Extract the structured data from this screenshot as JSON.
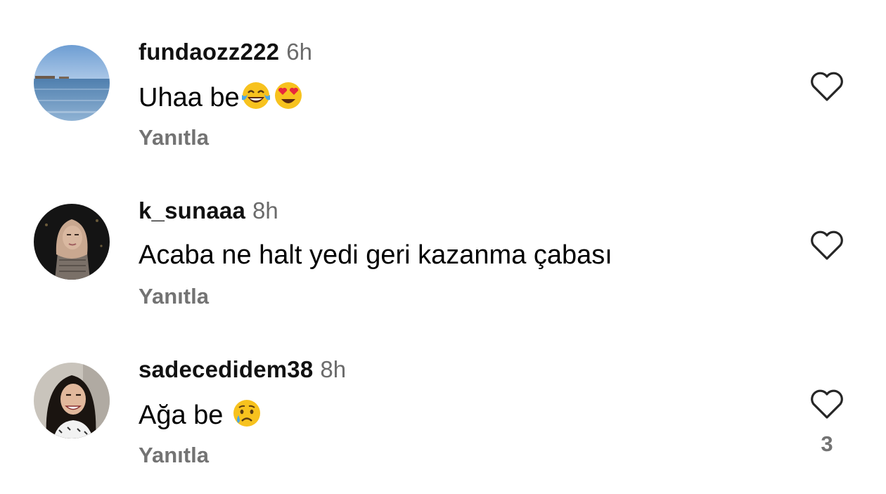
{
  "comments": [
    {
      "username": "fundaozz222",
      "time": "6h",
      "text": "Uhaa be",
      "emojis": [
        "face-with-tears-of-joy",
        "smiling-face-with-heart-eyes"
      ],
      "reply_label": "Yanıtla"
    },
    {
      "username": "k_sunaaa",
      "time": "8h",
      "text": "Acaba ne halt yedi geri kazanma çabası",
      "emojis": [],
      "reply_label": "Yanıtla"
    },
    {
      "username": "sadecedidem38",
      "time": "8h",
      "text": "Ağa be ",
      "emojis": [
        "crying-face"
      ],
      "reply_label": "Yanıtla",
      "like_count": "3"
    }
  ]
}
